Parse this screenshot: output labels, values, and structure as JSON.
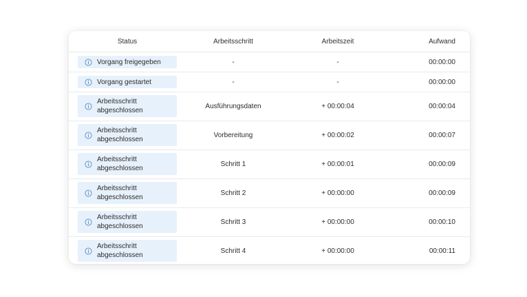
{
  "table": {
    "headers": {
      "status": "Status",
      "step": "Arbeitsschritt",
      "time": "Arbeitszeit",
      "effort": "Aufwand"
    },
    "rows": [
      {
        "status": "Vorgang freigegeben",
        "step": "-",
        "time": "-",
        "effort": "00:00:00"
      },
      {
        "status": "Vorgang gestartet",
        "step": "-",
        "time": "-",
        "effort": "00:00:00"
      },
      {
        "status": "Arbeitsschritt abgeschlossen",
        "step": "Ausführungsdaten",
        "time": "+ 00:00:04",
        "effort": "00:00:04"
      },
      {
        "status": "Arbeitsschritt abgeschlossen",
        "step": "Vorbereitung",
        "time": "+ 00:00:02",
        "effort": "00:00:07"
      },
      {
        "status": "Arbeitsschritt abgeschlossen",
        "step": "Schritt 1",
        "time": "+ 00:00:01",
        "effort": "00:00:09"
      },
      {
        "status": "Arbeitsschritt abgeschlossen",
        "step": "Schritt 2",
        "time": "+ 00:00:00",
        "effort": "00:00:09"
      },
      {
        "status": "Arbeitsschritt abgeschlossen",
        "step": "Schritt 3",
        "time": "+ 00:00:00",
        "effort": "00:00:10"
      },
      {
        "status": "Arbeitsschritt abgeschlossen",
        "step": "Schritt 4",
        "time": "+ 00:00:00",
        "effort": "00:00:11"
      }
    ]
  },
  "colors": {
    "status_pill_bg": "#e7f1fb",
    "info_icon": "#5b8ec9"
  },
  "icons": {
    "status": "info-circle-icon"
  }
}
